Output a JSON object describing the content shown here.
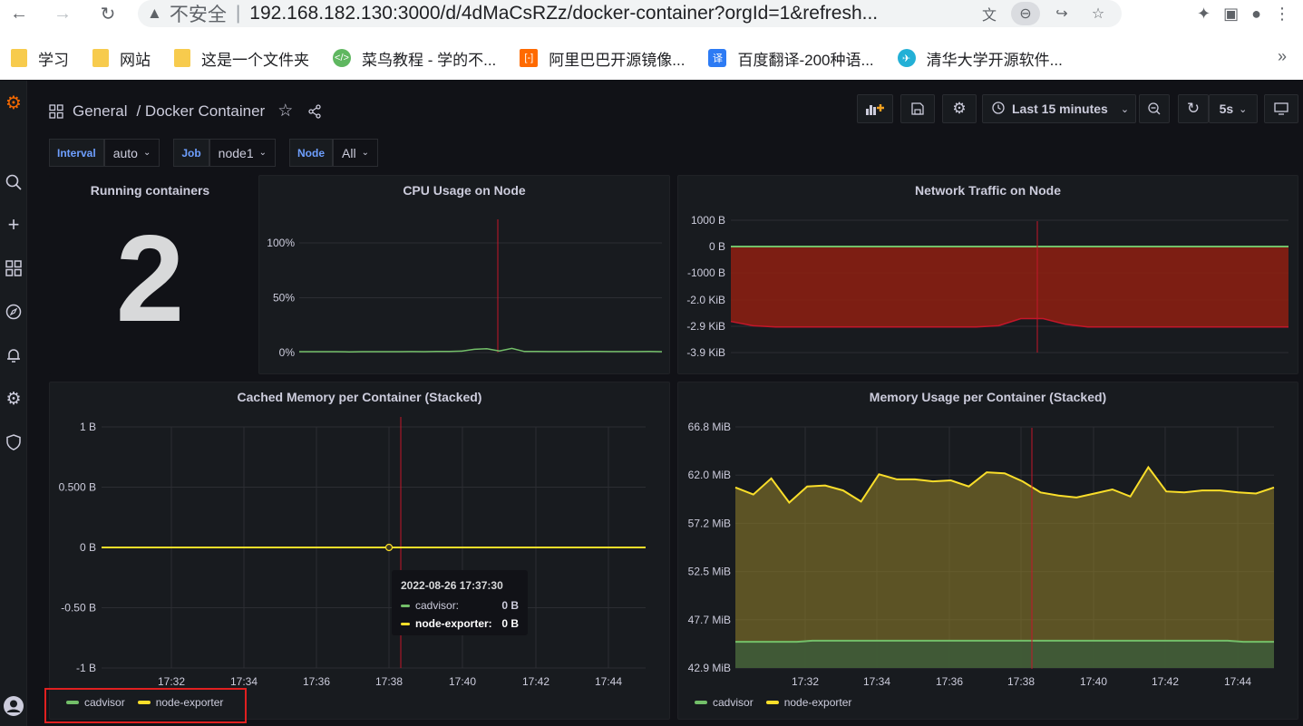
{
  "browser": {
    "nav_icons": [
      "back-icon",
      "forward-icon",
      "reload-icon"
    ],
    "security_label": "不安全",
    "url": "192.168.182.130:3000/d/4dMaCsRZz/docker-container?orgId=1&refresh...",
    "bookmarks": [
      {
        "label": "学习",
        "icon": "folder-icon"
      },
      {
        "label": "网站",
        "icon": "folder-icon"
      },
      {
        "label": "这是一个文件夹",
        "icon": "folder-icon"
      },
      {
        "label": "菜鸟教程 - 学的不...",
        "icon": "runoob-icon"
      },
      {
        "label": "阿里巴巴开源镜像...",
        "icon": "aliyun-icon"
      },
      {
        "label": "百度翻译-200种语...",
        "icon": "baidu-translate-icon"
      },
      {
        "label": "清华大学开源软件...",
        "icon": "tuna-icon"
      }
    ]
  },
  "dashboard": {
    "folder": "General",
    "title": "/ Docker Container",
    "time_range": "Last 15 minutes",
    "refresh_interval": "5s"
  },
  "variables": [
    {
      "label": "Interval",
      "value": "auto"
    },
    {
      "label": "Job",
      "value": "node1"
    },
    {
      "label": "Node",
      "value": "All"
    }
  ],
  "panels": {
    "running": {
      "title": "Running containers",
      "value": "2"
    },
    "cpu": {
      "title": "CPU Usage on Node",
      "y_ticks": [
        "100%",
        "50%",
        "0%"
      ]
    },
    "network": {
      "title": "Network Traffic on Node",
      "y_ticks": [
        "1000 B",
        "0 B",
        "-1000 B",
        "-2.0 KiB",
        "-2.9 KiB",
        "-3.9 KiB"
      ]
    },
    "cached": {
      "title": "Cached Memory per Container (Stacked)",
      "y_ticks": [
        "1 B",
        "0.500 B",
        "0 B",
        "-0.50 B",
        "-1 B"
      ],
      "x_ticks": [
        "17:32",
        "17:34",
        "17:36",
        "17:38",
        "17:40",
        "17:42",
        "17:44"
      ],
      "legend": [
        {
          "name": "cadvisor",
          "color": "#73bf69"
        },
        {
          "name": "node-exporter",
          "color": "#fade2a"
        }
      ],
      "tooltip": {
        "time": "2022-08-26 17:37:30",
        "rows": [
          {
            "name": "cadvisor:",
            "value": "0 B",
            "color": "#73bf69"
          },
          {
            "name": "node-exporter:",
            "value": "0 B",
            "color": "#fade2a"
          }
        ]
      }
    },
    "memory": {
      "title": "Memory Usage per Container (Stacked)",
      "y_ticks": [
        "66.8 MiB",
        "62.0 MiB",
        "57.2 MiB",
        "52.5 MiB",
        "47.7 MiB",
        "42.9 MiB"
      ],
      "x_ticks": [
        "17:32",
        "17:34",
        "17:36",
        "17:38",
        "17:40",
        "17:42",
        "17:44"
      ],
      "legend": [
        {
          "name": "cadvisor",
          "color": "#73bf69"
        },
        {
          "name": "node-exporter",
          "color": "#fade2a"
        }
      ]
    }
  },
  "chart_data": [
    {
      "type": "line",
      "title": "CPU Usage on Node",
      "ylim": [
        0,
        100
      ],
      "y_unit": "%",
      "series": [
        {
          "values": [
            0.8,
            0.8,
            0.8,
            0.8,
            0.7,
            0.8,
            0.8,
            0.8,
            0.8,
            0.9,
            0.8,
            1.0,
            1.0,
            1.3,
            3.0,
            3.5,
            1.5,
            3.8,
            1.0,
            1.0,
            0.9,
            0.9,
            0.9,
            1.0,
            1.0,
            0.9,
            0.9,
            0.9,
            1.0,
            0.8
          ]
        }
      ]
    },
    {
      "type": "area",
      "title": "Network Traffic on Node",
      "y_unit": "B",
      "series": [
        {
          "values": [
            0,
            0,
            0,
            0,
            0,
            0,
            0,
            0,
            0,
            0,
            0,
            0,
            0,
            0,
            0,
            0,
            0,
            0,
            0,
            0,
            0,
            0,
            0,
            0,
            0,
            0
          ]
        },
        {
          "values": [
            -2800,
            -2950,
            -3000,
            -3000,
            -3000,
            -3000,
            -3000,
            -3000,
            -3000,
            -3000,
            -3000,
            -3000,
            -2950,
            -2700,
            -2700,
            -2900,
            -3000,
            -3000,
            -3000,
            -3000,
            -3000,
            -3000,
            -3000,
            -3000,
            -3000,
            -3000
          ]
        }
      ]
    },
    {
      "type": "line",
      "title": "Cached Memory per Container (Stacked)",
      "ylim": [
        -1,
        1
      ],
      "y_unit": "B",
      "series": [
        {
          "name": "cadvisor",
          "values": [
            0,
            0
          ]
        },
        {
          "name": "node-exporter",
          "values": [
            0,
            0
          ]
        }
      ]
    },
    {
      "type": "area",
      "title": "Memory Usage per Container (Stacked)",
      "ylim": [
        42.9,
        66.8
      ],
      "y_unit": "MiB",
      "series": [
        {
          "name": "cadvisor",
          "values": [
            45.5,
            45.5,
            45.5,
            45.5,
            45.5,
            45.6,
            45.6,
            45.6,
            45.6,
            45.6,
            45.6,
            45.6,
            45.6,
            45.6,
            45.6,
            45.6,
            45.6,
            45.6,
            45.6,
            45.6,
            45.6,
            45.6,
            45.6,
            45.6,
            45.6,
            45.6,
            45.6,
            45.6,
            45.6,
            45.6,
            45.6,
            45.6,
            45.6,
            45.5,
            45.5,
            45.5
          ]
        },
        {
          "name": "node-exporter",
          "values": [
            60.8,
            60.1,
            61.7,
            59.3,
            60.9,
            61.0,
            60.5,
            59.4,
            62.1,
            61.6,
            61.6,
            61.4,
            61.5,
            60.9,
            62.3,
            62.2,
            61.4,
            60.3,
            60.0,
            59.8,
            60.2,
            60.6,
            59.9,
            62.8,
            60.4,
            60.3,
            60.5,
            60.5,
            60.3,
            60.2,
            60.8
          ]
        }
      ]
    }
  ]
}
